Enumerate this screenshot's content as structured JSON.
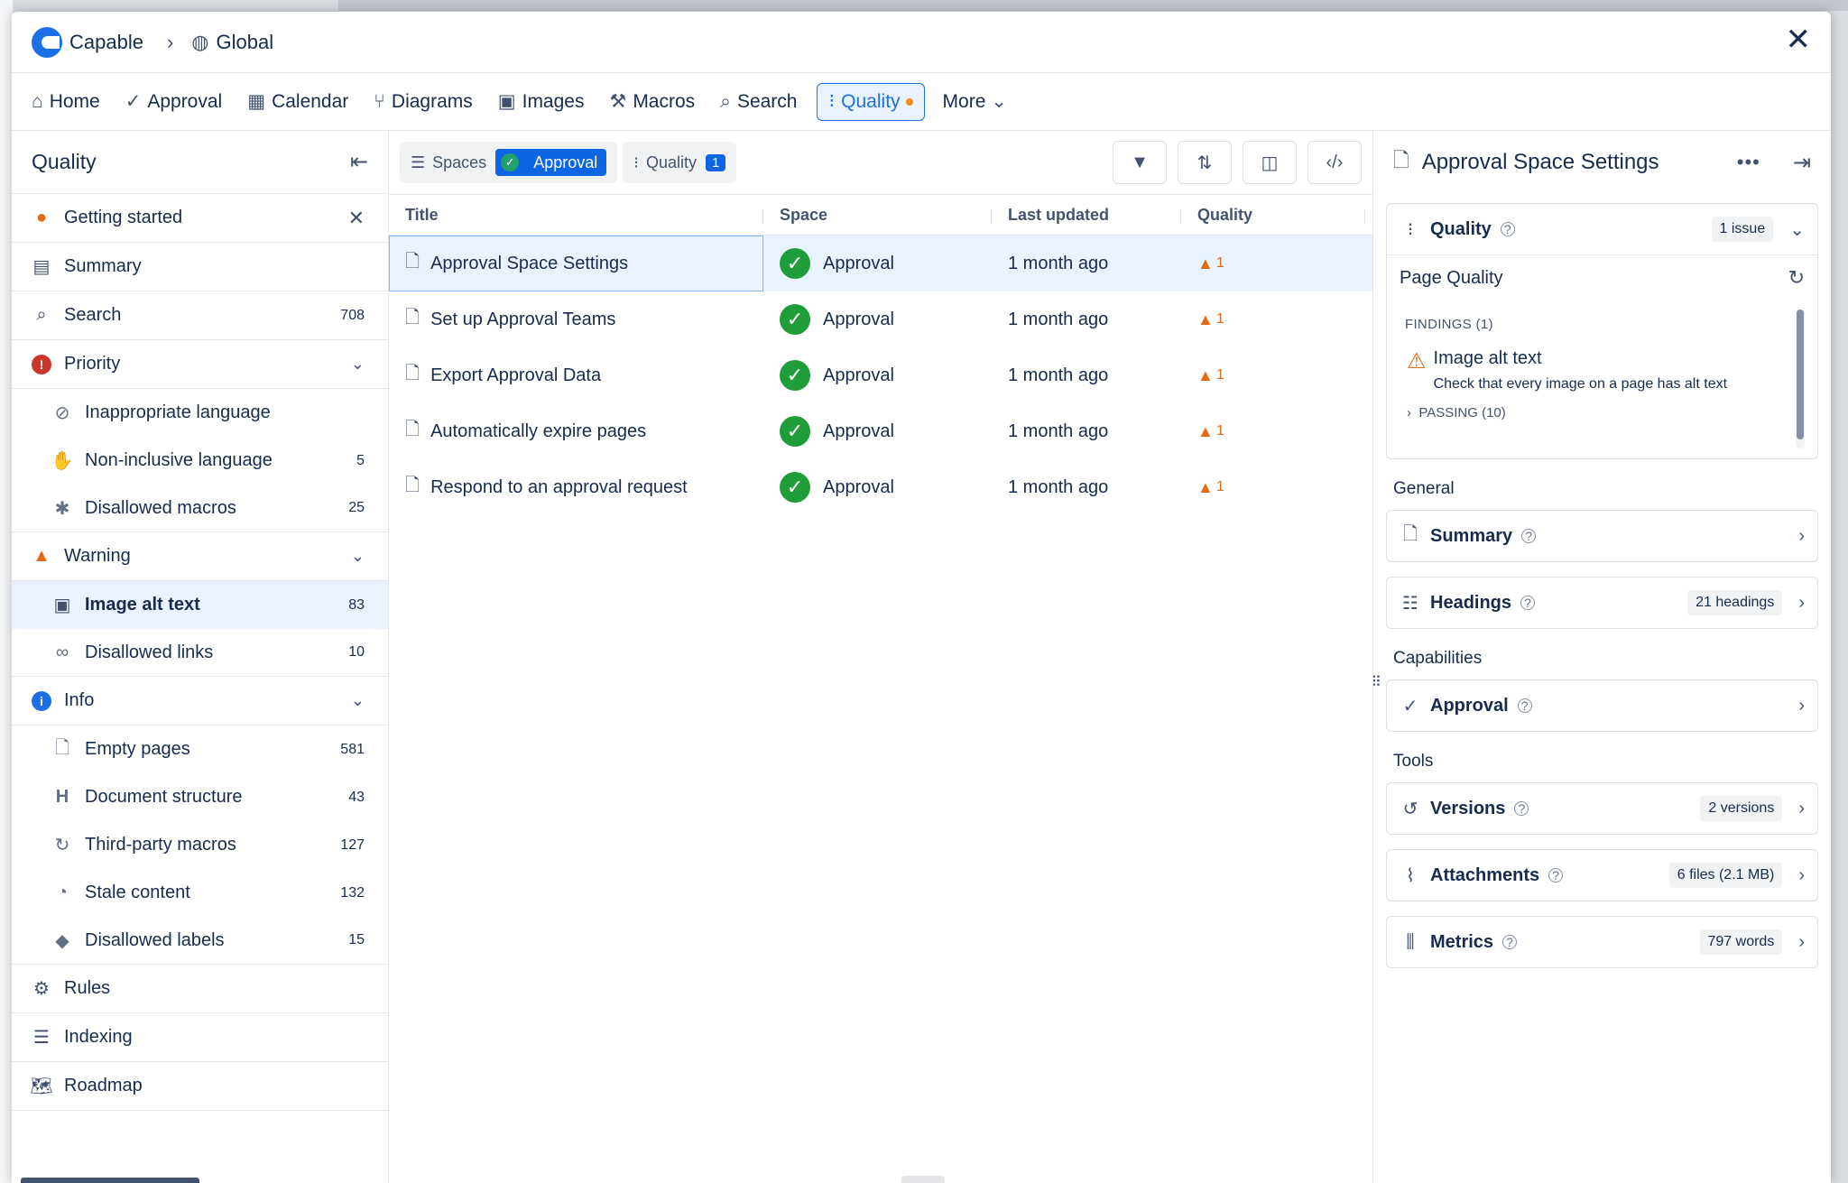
{
  "header": {
    "brand": "Capable",
    "breadcrumb": "Global",
    "close": "✕"
  },
  "nav": [
    {
      "label": "Home",
      "icon": "home-icon",
      "glyph": "⌂"
    },
    {
      "label": "Approval",
      "icon": "check-circle-icon",
      "glyph": "✓"
    },
    {
      "label": "Calendar",
      "icon": "calendar-icon",
      "glyph": "▦"
    },
    {
      "label": "Diagrams",
      "icon": "diagram-icon",
      "glyph": "⑂"
    },
    {
      "label": "Images",
      "icon": "image-icon",
      "glyph": "▣"
    },
    {
      "label": "Macros",
      "icon": "macros-icon",
      "glyph": "⚒"
    },
    {
      "label": "Search",
      "icon": "search-icon",
      "glyph": "⌕"
    },
    {
      "label": "Quality",
      "icon": "traffic-light-icon",
      "glyph": "⁝",
      "active": true
    },
    {
      "label": "More",
      "icon": "chevron-down-icon",
      "glyph": "⌄"
    }
  ],
  "sidebar": {
    "title": "Quality",
    "getting_started": "Getting started",
    "summary": "Summary",
    "search": {
      "label": "Search",
      "count": "708"
    },
    "priority": {
      "label": "Priority",
      "items": [
        {
          "label": "Inappropriate language",
          "count": ""
        },
        {
          "label": "Non-inclusive language",
          "count": "5"
        },
        {
          "label": "Disallowed macros",
          "count": "25"
        }
      ]
    },
    "warning": {
      "label": "Warning",
      "items": [
        {
          "label": "Image alt text",
          "count": "83"
        },
        {
          "label": "Disallowed links",
          "count": "10"
        }
      ]
    },
    "info": {
      "label": "Info",
      "items": [
        {
          "label": "Empty pages",
          "count": "581"
        },
        {
          "label": "Document structure",
          "count": "43"
        },
        {
          "label": "Third-party macros",
          "count": "127"
        },
        {
          "label": "Stale content",
          "count": "132"
        },
        {
          "label": "Disallowed labels",
          "count": "15"
        }
      ]
    },
    "rules": "Rules",
    "indexing": "Indexing",
    "roadmap": "Roadmap"
  },
  "filters": {
    "spaces_label": "Spaces",
    "spaces_value": "Approval",
    "quality_label": "Quality",
    "quality_count": "1"
  },
  "table": {
    "columns": [
      "Title",
      "Space",
      "Last updated",
      "Quality"
    ],
    "rows": [
      {
        "title": "Approval Space Settings",
        "space": "Approval",
        "updated": "1 month ago",
        "quality": "1"
      },
      {
        "title": "Set up Approval Teams",
        "space": "Approval",
        "updated": "1 month ago",
        "quality": "1"
      },
      {
        "title": "Export Approval Data",
        "space": "Approval",
        "updated": "1 month ago",
        "quality": "1"
      },
      {
        "title": "Automatically expire pages",
        "space": "Approval",
        "updated": "1 month ago",
        "quality": "1"
      },
      {
        "title": "Respond to an approval request",
        "space": "Approval",
        "updated": "1 month ago",
        "quality": "1"
      }
    ]
  },
  "panel": {
    "title": "Approval Space Settings",
    "quality": {
      "label": "Quality",
      "pill": "1 issue"
    },
    "page_quality": "Page Quality",
    "findings_label": "FINDINGS (1)",
    "finding_title": "Image alt text",
    "finding_desc": "Check that every image on a page has alt text",
    "passing_label": "PASSING (10)",
    "general": "General",
    "summary": "Summary",
    "headings": {
      "label": "Headings",
      "pill": "21 headings"
    },
    "capabilities": "Capabilities",
    "approval": "Approval",
    "tools": "Tools",
    "versions": {
      "label": "Versions",
      "pill": "2 versions"
    },
    "attachments": {
      "label": "Attachments",
      "pill": "6 files (2.1 MB)"
    },
    "metrics": {
      "label": "Metrics",
      "pill": "797 words"
    }
  },
  "colors": {
    "accent": "#1d6fe8",
    "warning": "#e56910",
    "success": "#1f9d3a",
    "selected_bg": "#e9f2ff"
  }
}
